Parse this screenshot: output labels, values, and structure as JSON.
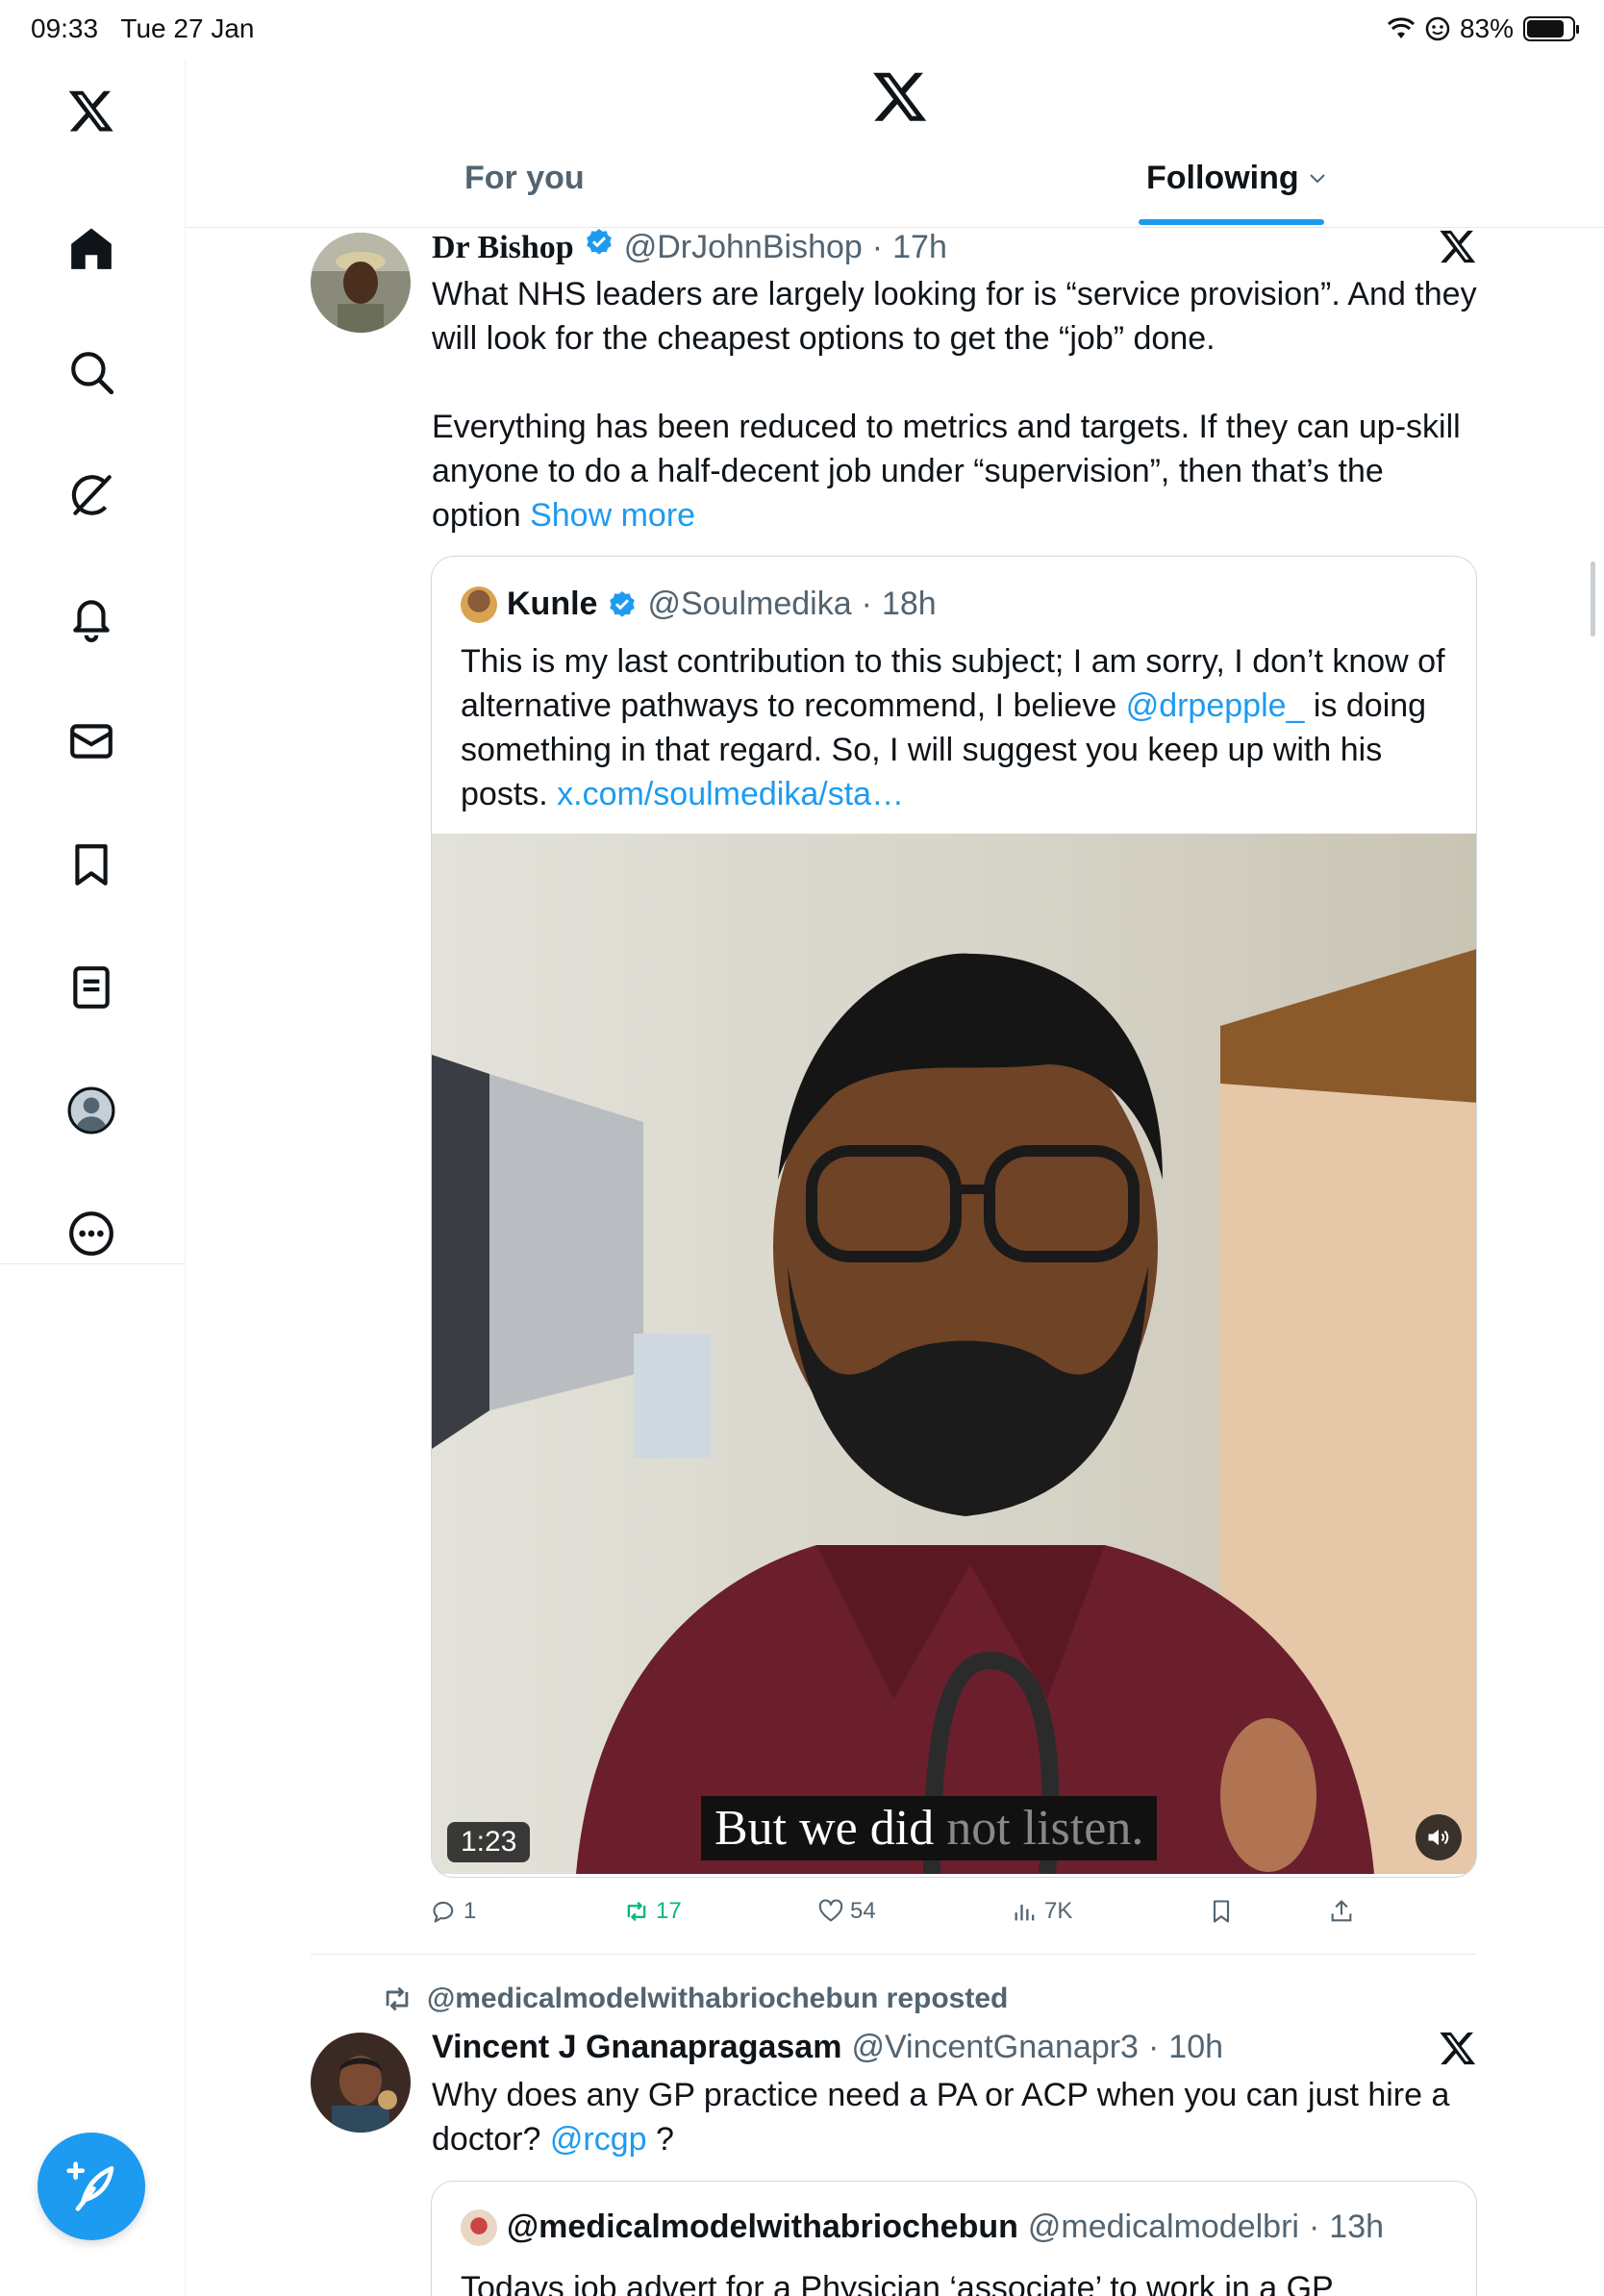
{
  "status_bar": {
    "time": "09:33",
    "date": "Tue 27 Jan",
    "battery": "83%",
    "battery_level": 0.83
  },
  "sidebar": {
    "items": [
      {
        "icon": "x-logo-icon"
      },
      {
        "icon": "home-icon"
      },
      {
        "icon": "search-icon"
      },
      {
        "icon": "grok-icon"
      },
      {
        "icon": "bell-icon"
      },
      {
        "icon": "mail-icon"
      },
      {
        "icon": "bookmark-icon"
      },
      {
        "icon": "list-icon"
      },
      {
        "icon": "profile-icon"
      },
      {
        "icon": "more-icon"
      }
    ],
    "compose_icon": "compose-icon"
  },
  "header": {
    "tabs": [
      {
        "label": "For you",
        "active": false
      },
      {
        "label": "Following",
        "active": true
      }
    ]
  },
  "colors": {
    "accent": "#1d9bf0",
    "text": "#0f1419",
    "secondary": "#536471",
    "retweet_green": "#00ba7c"
  },
  "tweets": [
    {
      "display_name": "Dr Bishop",
      "handle": "@DrJohnBishop",
      "time": "17h",
      "text_1": "What NHS leaders are largely looking for is “service provision”. And they will look for the cheapest options to get the “job” done.",
      "text_2": "Everything has been reduced to metrics and targets. If they can up-skill anyone to do a half-decent job under “supervision”, then that’s the option",
      "show_more": "Show more",
      "quote": {
        "display_name": "Kunle",
        "handle": "@Soulmedika",
        "time": "18h",
        "text_before": "This is my last contribution to this subject; I am sorry, I don’t know of alternative pathways to recommend, I believe ",
        "mention": "@drpepple_",
        "text_after": " is doing something in that regard. So, I will suggest you keep up with his posts. ",
        "link": "x.com/soulmedika/sta…",
        "video": {
          "duration": "1:23",
          "caption_visible": "But we did",
          "caption_faded": " not listen."
        }
      },
      "stats": {
        "replies": "1",
        "retweets": "17",
        "likes": "54",
        "views": "7K"
      }
    },
    {
      "repost_by": "@medicalmodelwithabriochebun reposted",
      "display_name": "Vincent J Gnanapragasam",
      "handle": "@VincentGnanapr3",
      "time": "10h",
      "text_before": "Why does any GP practice need a PA or ACP when you can just hire a doctor? ",
      "mention": "@rcgp",
      "text_after": " ?",
      "quote": {
        "display_name": "@medicalmodelwithabriochebun",
        "handle": "@medicalmodelbri",
        "time": "13h",
        "text": "Todays job advert for a Physician ‘associate’ to work in a GP"
      }
    }
  ]
}
